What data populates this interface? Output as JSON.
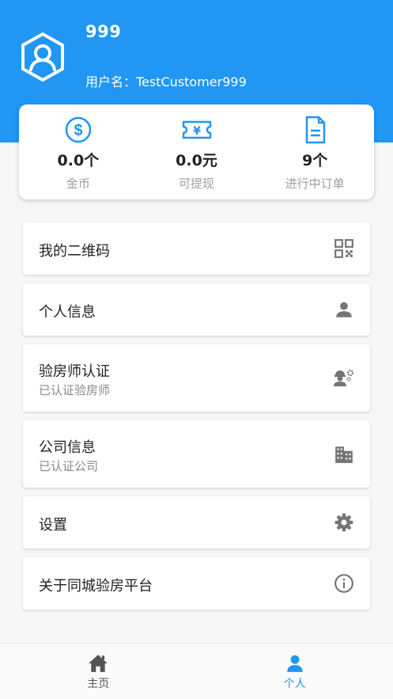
{
  "profile": {
    "username": "999",
    "account": "用户名：TestCustomer999"
  },
  "stats": [
    {
      "value": "0.0个",
      "label": "金币",
      "icon": "dollar-coin-icon"
    },
    {
      "value": "0.0元",
      "label": "可提现",
      "icon": "yuan-ticket-icon"
    },
    {
      "value": "9个",
      "label": "进行中订单",
      "icon": "document-icon"
    }
  ],
  "menu": [
    {
      "title": "我的二维码",
      "icon": "qr-code-icon"
    },
    {
      "title": "个人信息",
      "icon": "person-icon"
    },
    {
      "title": "验房师认证",
      "subtitle": "已认证验房师",
      "icon": "engineer-gear-icon"
    },
    {
      "title": "公司信息",
      "subtitle": "已认证公司",
      "icon": "building-icon"
    },
    {
      "title": "设置",
      "icon": "settings-gear-icon"
    },
    {
      "title": "关于同城验房平台",
      "icon": "info-icon"
    }
  ],
  "nav": [
    {
      "label": "主页",
      "icon": "home-icon"
    },
    {
      "label": "个人",
      "icon": "person-icon",
      "active": true
    }
  ],
  "colors": {
    "primary": "#2196f3",
    "icon_gray": "#757575",
    "muted_text": "#9e9e9e"
  }
}
